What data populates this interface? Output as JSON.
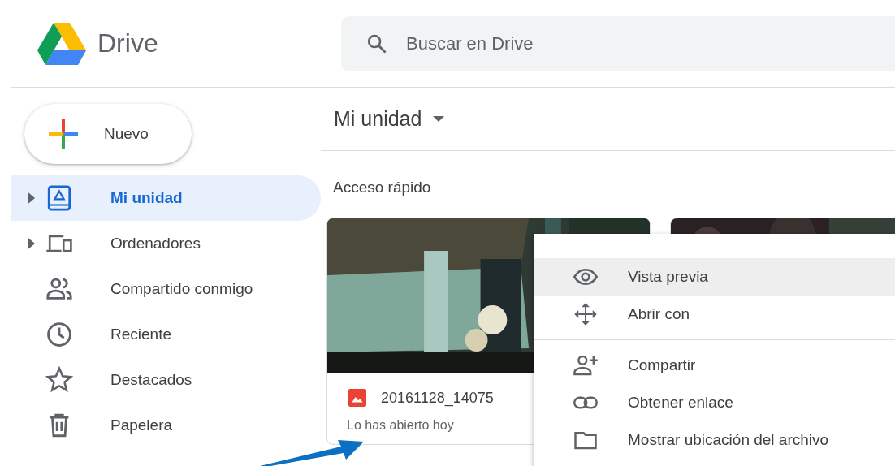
{
  "app": {
    "name": "Drive"
  },
  "search": {
    "placeholder": "Buscar en Drive"
  },
  "new_button": {
    "label": "Nuevo"
  },
  "sidebar": {
    "items": [
      {
        "label": "Mi unidad",
        "expandable": true,
        "selected": true
      },
      {
        "label": "Ordenadores",
        "expandable": true,
        "selected": false
      },
      {
        "label": "Compartido conmigo",
        "expandable": false,
        "selected": false
      },
      {
        "label": "Reciente",
        "expandable": false,
        "selected": false
      },
      {
        "label": "Destacados",
        "expandable": false,
        "selected": false
      },
      {
        "label": "Papelera",
        "expandable": false,
        "selected": false
      }
    ]
  },
  "breadcrumb": {
    "label": "Mi unidad"
  },
  "quick_access": {
    "title": "Acceso rápido",
    "cards": [
      {
        "kind": "file",
        "name": "20161128_14075",
        "subtitle": "Lo has abierto hoy"
      },
      {
        "kind": "picture"
      }
    ]
  },
  "context_menu": {
    "groups": [
      [
        {
          "label": "Vista previa",
          "selected": true
        },
        {
          "label": "Abrir con",
          "selected": false
        }
      ],
      [
        {
          "label": "Compartir",
          "selected": false
        },
        {
          "label": "Obtener enlace",
          "selected": false
        },
        {
          "label": "Mostrar ubicación del archivo",
          "selected": false
        }
      ]
    ]
  }
}
